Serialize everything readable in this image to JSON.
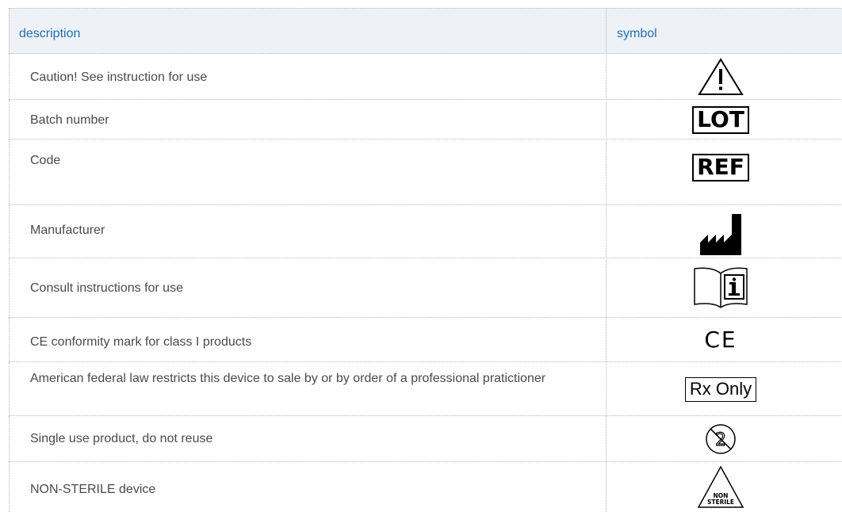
{
  "table": {
    "headers": {
      "description": "description",
      "symbol": "symbol"
    },
    "rows": [
      {
        "description": "Caution! See instruction for use",
        "symbol_icon": "caution-warning-triangle-icon"
      },
      {
        "description": "Batch number",
        "symbol_text": "LOT",
        "symbol_icon": "lot-icon"
      },
      {
        "description": "Code",
        "symbol_text": "REF",
        "symbol_icon": "ref-icon"
      },
      {
        "description": "Manufacturer",
        "symbol_icon": "manufacturer-factory-icon"
      },
      {
        "description": "Consult instructions for use",
        "symbol_icon": "consult-instructions-book-icon"
      },
      {
        "description": "CE conformity mark for class I products",
        "symbol_text": "CE",
        "symbol_icon": "ce-mark-icon"
      },
      {
        "description": "American federal law restricts this device to sale by or by order of a professional pratictioner",
        "symbol_text": "Rx Only",
        "symbol_icon": "rx-only-icon"
      },
      {
        "description": "Single use product, do not reuse",
        "symbol_icon": "single-use-do-not-reuse-icon"
      },
      {
        "description": "NON-STERILE device",
        "symbol_text": [
          "NON",
          "STERILE"
        ],
        "symbol_icon": "non-sterile-triangle-icon"
      }
    ]
  },
  "colors": {
    "header_background": "#eef2f6",
    "header_text": "#1f6fb2",
    "body_text": "#4a4a4a",
    "border": "#b7b7b7"
  }
}
